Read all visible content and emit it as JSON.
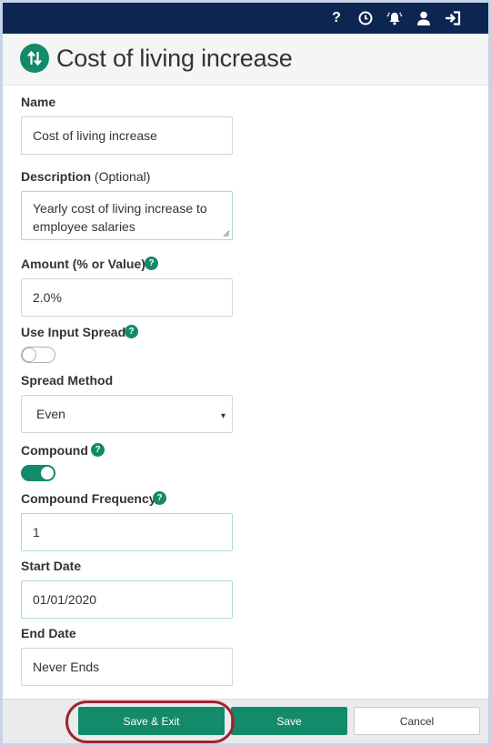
{
  "topbar": {
    "icons": [
      "help-icon",
      "history-clock-icon",
      "alarm-bell-icon",
      "user-icon",
      "sign-out-icon"
    ],
    "help_glyph": "?"
  },
  "header": {
    "icon": "transfer-arrows-icon",
    "title": "Cost of living increase"
  },
  "form": {
    "name": {
      "label": "Name",
      "value": "Cost of living increase"
    },
    "description": {
      "label": "Description",
      "optional": "(Optional)",
      "value": "Yearly cost of living increase to employee salaries"
    },
    "amount": {
      "label": "Amount (% or Value)",
      "value": "2.0%"
    },
    "use_input_spread": {
      "label": "Use Input Spread",
      "on": false
    },
    "spread_method": {
      "label": "Spread Method",
      "value": "Even",
      "caret": "▾"
    },
    "compound": {
      "label": "Compound",
      "on": true
    },
    "compound_frequency": {
      "label": "Compound Frequency",
      "value": "1"
    },
    "start_date": {
      "label": "Start Date",
      "value": "01/01/2020"
    },
    "end_date": {
      "label": "End Date",
      "value": "Never Ends"
    },
    "help_glyph": "?"
  },
  "footer": {
    "save_exit": "Save & Exit",
    "save": "Save",
    "cancel": "Cancel"
  },
  "colors": {
    "navy": "#0c2551",
    "accent_green": "#138a6a",
    "highlight_ring": "#a0232e"
  }
}
